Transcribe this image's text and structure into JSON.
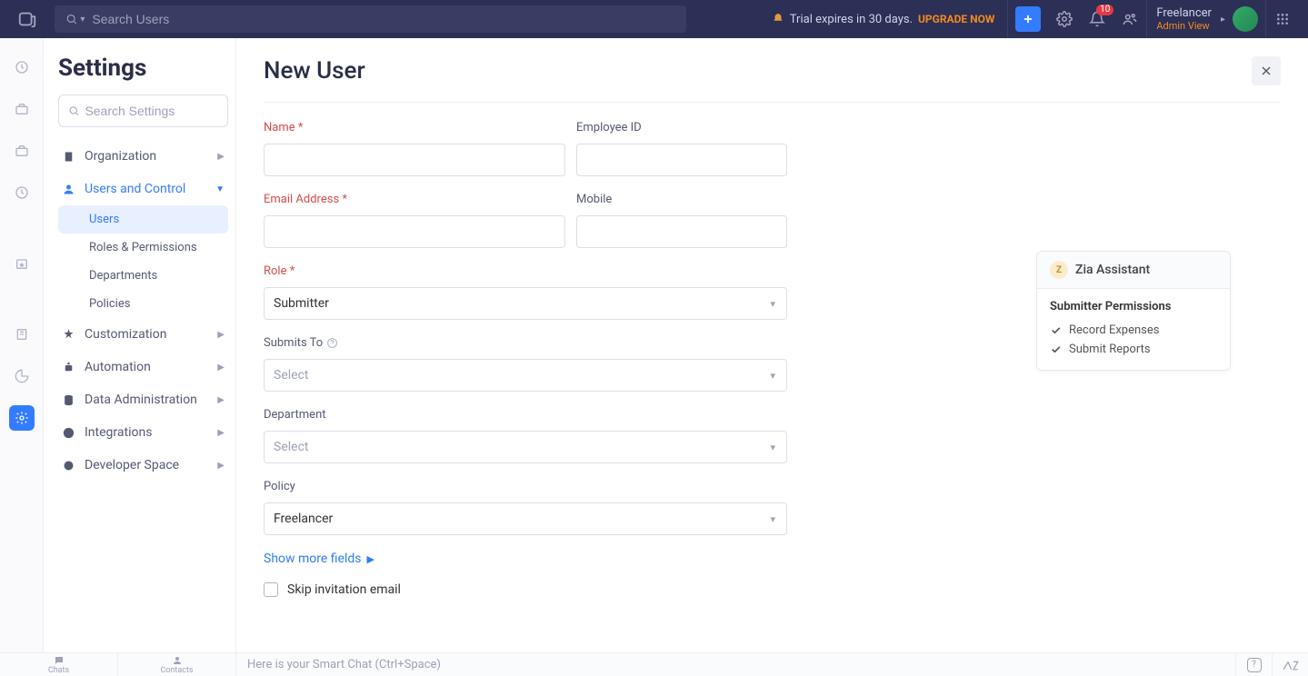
{
  "topbar": {
    "search_placeholder": "Search Users",
    "trial_text": "Trial expires in 30 days.",
    "upgrade_label": "UPGRADE NOW",
    "notif_count": "10",
    "user_name": "Freelancer",
    "user_role": "Admin View"
  },
  "sidebar": {
    "title": "Settings",
    "search_placeholder": "Search Settings",
    "groups": [
      {
        "label": "Organization"
      },
      {
        "label": "Users and Control"
      },
      {
        "label": "Customization"
      },
      {
        "label": "Automation"
      },
      {
        "label": "Data Administration"
      },
      {
        "label": "Integrations"
      },
      {
        "label": "Developer Space"
      }
    ],
    "users_sub": [
      {
        "label": "Users"
      },
      {
        "label": "Roles & Permissions"
      },
      {
        "label": "Departments"
      },
      {
        "label": "Policies"
      }
    ]
  },
  "form": {
    "title": "New User",
    "name_label": "Name *",
    "employee_label": "Employee ID",
    "email_label": "Email Address *",
    "mobile_label": "Mobile",
    "role_label": "Role *",
    "role_value": "Submitter",
    "submits_label": "Submits To",
    "submits_value": "Select",
    "department_label": "Department",
    "department_value": "Select",
    "policy_label": "Policy",
    "policy_value": "Freelancer",
    "show_more": "Show more fields",
    "skip_label": "Skip invitation email"
  },
  "assistant": {
    "title": "Zia Assistant",
    "perm_title": "Submitter Permissions",
    "perms": [
      "Record Expenses",
      "Submit Reports"
    ]
  },
  "bottombar": {
    "chats": "Chats",
    "contacts": "Contacts",
    "smart_chat": "Here is your Smart Chat (Ctrl+Space)"
  }
}
